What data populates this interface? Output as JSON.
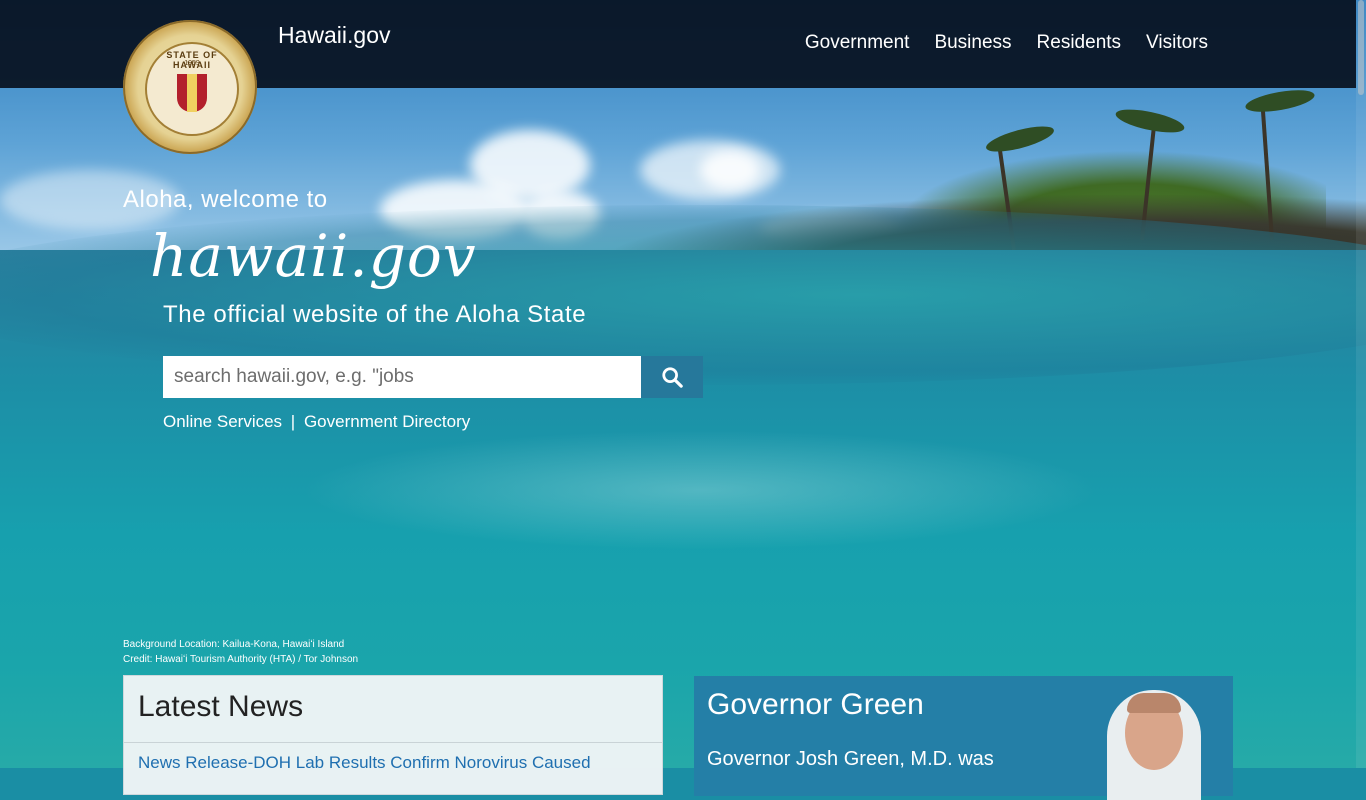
{
  "header": {
    "site_name": "Hawaii.gov",
    "seal_text": "STATE OF HAWAII",
    "seal_year": "1959",
    "nav": [
      "Government",
      "Business",
      "Residents",
      "Visitors"
    ]
  },
  "hero": {
    "welcome": "Aloha, welcome to",
    "script_logo": "hawaii.gov",
    "tagline": "The official website of the Aloha State",
    "search": {
      "placeholder": "search hawaii.gov, e.g. \"jobs",
      "button_icon": "search-icon"
    },
    "links": {
      "online_services": "Online Services",
      "separator": "|",
      "directory": "Government Directory"
    },
    "credit_line1": "Background Location: Kailua-Kona, Hawaiʻi Island",
    "credit_line2": "Credit: Hawaiʻi Tourism Authority (HTA) / Tor Johnson"
  },
  "news": {
    "title": "Latest News",
    "first_item": "News Release-DOH Lab Results Confirm Norovirus Caused"
  },
  "governor": {
    "title": "Governor Green",
    "text": "Governor Josh Green, M.D. was"
  }
}
